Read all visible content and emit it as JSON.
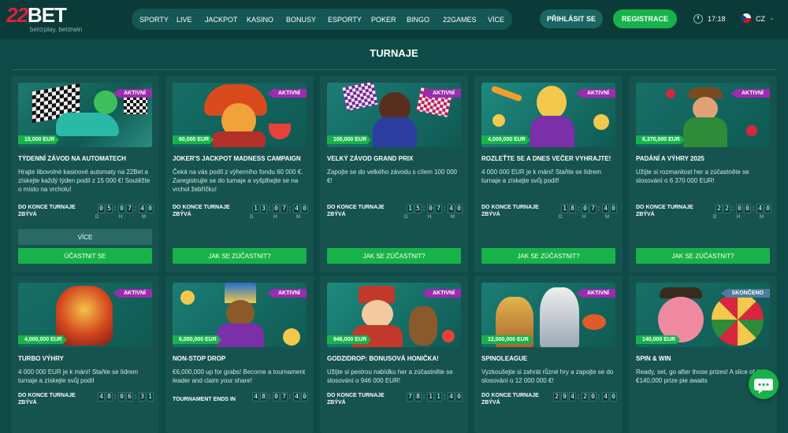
{
  "header": {
    "logo_main_a": "22",
    "logo_main_b": "BET",
    "logo_sub": "bet⊙play. bet⊘win",
    "nav": [
      "SPORTY",
      "LIVE",
      "JACKPOT",
      "KASINO",
      "BONUSY",
      "ESPORTY",
      "POKER",
      "BINGO",
      "22GAMES",
      "VÍCE"
    ],
    "login": "PŘIHLÁSIT SE",
    "register": "REGISTRACE",
    "time": "17:18",
    "lang": "CZ"
  },
  "page_title": "TURNAJE",
  "common": {
    "timer_label": "DO KONCE TURNAJE ZBÝVÁ",
    "unit_d": "D",
    "unit_h": "H",
    "unit_m": "M",
    "more": "VÍCE",
    "join": "ÚČASTNIT SE",
    "how_to": "JAK SE ZÚČASTNIT?",
    "active": "AKTIVNÍ",
    "ended": "SKONČENO"
  },
  "cards": [
    {
      "title": "TÝDENNÍ ZÁVOD NA AUTOMATECH",
      "desc": "Hrajte libovolné kasinové automaty na 22Bet a získejte každý týden podíl z 15 000 €! Soutěžte o místo na vrcholu!",
      "prize": "15,000 EUR",
      "digits": [
        "0",
        "5",
        "0",
        "7",
        "4",
        "0"
      ]
    },
    {
      "title": "JOKER'S JACKPOT MADNESS CAMPAIGN",
      "desc": "Čeká na vás podíl z výherního fondu 60 000 €. Zaregistrujte se do turnaje a vyšplhejte se na vrchol žebříčku!",
      "prize": "60,000 EUR",
      "digits": [
        "1",
        "3",
        "0",
        "7",
        "4",
        "0"
      ]
    },
    {
      "title": "VELKÝ ZÁVOD GRAND PRIX",
      "desc": "Zapojte se do velkého závodu s cílem 100 000 €!",
      "prize": "100,000 EUR",
      "digits": [
        "1",
        "5",
        "0",
        "7",
        "4",
        "0"
      ]
    },
    {
      "title": "ROZLEŤTE SE A DNES VEČER VYHRAJTE!",
      "desc": "4 000 000 EUR je k mání! Staňte se lídrem turnaje a získejte svůj podíl!",
      "prize": "4,000,000 EUR",
      "digits": [
        "1",
        "8",
        "0",
        "7",
        "4",
        "0"
      ]
    },
    {
      "title": "PADÁNÍ A VÝHRY 2025",
      "desc": "Užijte si rozmanitost her a zúčastněte se slosování o 6 370 000 EUR!",
      "prize": "6,370,000 EUR",
      "digits": [
        "2",
        "2",
        "0",
        "0",
        "4",
        "0"
      ]
    },
    {
      "title": "TURBO VÝHRY",
      "desc": "4 000 000 EUR je k mání! Staňte se lídrem turnaje a získejte svůj podíl",
      "prize": "4,000,000 EUR",
      "digits": [
        "4",
        "8",
        "0",
        "6",
        "3",
        "1"
      ]
    },
    {
      "title": "NON-STOP DROP",
      "desc": "€6,000,000 up for grabs! Become a tournament leader and claim your share!",
      "prize": "6,000,000 EUR",
      "timer_label": "TOURNAMENT ENDS IN",
      "digits": [
        "4",
        "8",
        "0",
        "7",
        "4",
        "0"
      ]
    },
    {
      "title": "GODZIDROP: BONUSOVÁ HONIČKA!",
      "desc": "Užijte si pestrou nabídku her a zúčastněte se slosování o 946 000 EUR!",
      "prize": "946,000 EUR",
      "digits": [
        "7",
        "8",
        "1",
        "1",
        "4",
        "0"
      ]
    },
    {
      "title": "SPINOLEAGUE",
      "desc": "Vyzkoušejte si zahrát různé hry a zapojte se do slosování o 12 000 000 €!",
      "prize": "12,000,000 EUR",
      "digits": [
        "2",
        "9",
        "4",
        "2",
        "0",
        "4",
        "0"
      ]
    },
    {
      "title": "SPIN & WIN",
      "desc": "Ready, set, go after those prizes! A slice of the €140,000 prize pie awaits",
      "prize": "140,000 EUR"
    }
  ],
  "colors": {
    "bg": "#0e4a47",
    "card": "#16534f",
    "green": "#17b34a",
    "badge_active": "#9b2bb0",
    "brand_red": "#e3203b"
  }
}
